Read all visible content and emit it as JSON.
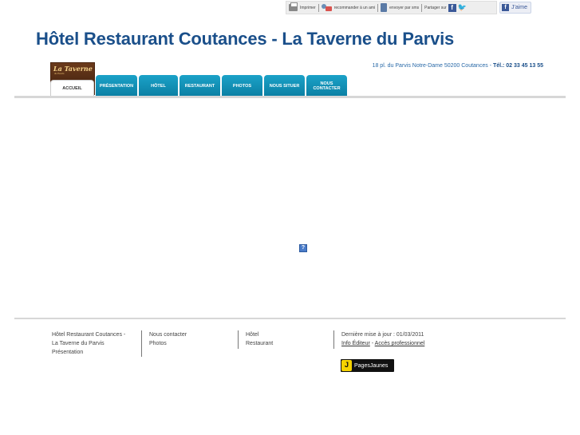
{
  "toolbar": {
    "print_label": "Imprimer",
    "recommend_label": "recommander à un ami",
    "sms_label": "envoyer par sms",
    "share_label": "Partager sur",
    "facebook_glyph": "f",
    "twitter_glyph": "🐦",
    "like_label": "J'aime"
  },
  "header": {
    "title": "Hôtel Restaurant Coutances - La Taverne du Parvis",
    "address": "18 pl. du Parvis Notre-Dame 50200 Coutances",
    "address_sep": " - ",
    "tel": "Tél.: 02 33 45 13 55"
  },
  "logo": {
    "text": "La Taverne",
    "subtext": "du Parvis"
  },
  "nav": {
    "tabs": [
      {
        "label": "ACCUEIL",
        "active": true
      },
      {
        "label": "PRÉSENTATION"
      },
      {
        "label": "HÔTEL"
      },
      {
        "label": "RESTAURANT"
      },
      {
        "label": "PHOTOS"
      },
      {
        "label": "NOUS SITUER"
      },
      {
        "label": "NOUS CONTACTER"
      }
    ]
  },
  "plugin": {
    "glyph": "?"
  },
  "footer": {
    "col1": [
      "Hôtel Restaurant Coutances -",
      "La Taverne du Parvis",
      "Présentation"
    ],
    "col2": [
      "Nous contacter",
      "Photos"
    ],
    "col3": [
      "Hôtel",
      "Restaurant"
    ],
    "col4": {
      "updated": "Dernière mise à jour : 01/03/2011",
      "info_editeur": "Info Éditeur",
      "sep": " - ",
      "acces_pro": "Accès professionnel"
    },
    "pages_jaunes": {
      "glyph": "J",
      "label": "PagesJaunes"
    }
  },
  "colors": {
    "title": "#1a4f8a",
    "tab": "#1ba2c8",
    "address": "#2a6aa8"
  }
}
